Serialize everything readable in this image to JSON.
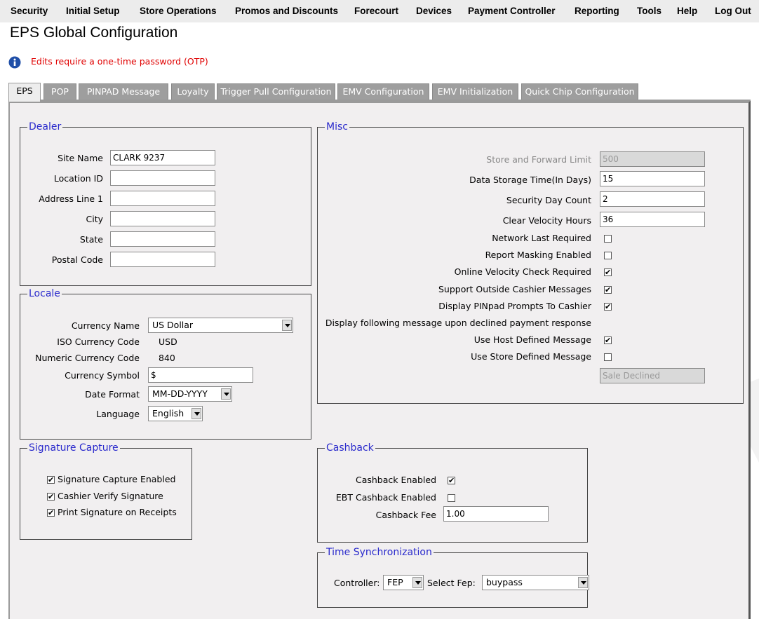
{
  "menu": [
    {
      "id": "security",
      "label": "Security"
    },
    {
      "id": "initial-setup",
      "label": "Initial Setup"
    },
    {
      "id": "store-operations",
      "label": "Store Operations"
    },
    {
      "id": "promos",
      "label": "Promos and Discounts"
    },
    {
      "id": "forecourt",
      "label": "Forecourt"
    },
    {
      "id": "devices",
      "label": "Devices"
    },
    {
      "id": "payment-controller",
      "label": "Payment Controller"
    },
    {
      "id": "reporting",
      "label": "Reporting"
    },
    {
      "id": "tools",
      "label": "Tools"
    },
    {
      "id": "help",
      "label": "Help"
    },
    {
      "id": "logout",
      "label": "Log Out"
    }
  ],
  "page": {
    "title": "EPS Global Configuration",
    "otp_message": "Edits require a one-time password (OTP)"
  },
  "tabs": [
    {
      "label": "EPS",
      "active": true
    },
    {
      "label": "POP"
    },
    {
      "label": "PINPAD Message"
    },
    {
      "label": "Loyalty"
    },
    {
      "label": "Trigger Pull Configuration"
    },
    {
      "label": "EMV Configuration"
    },
    {
      "label": "EMV Initialization"
    },
    {
      "label": "Quick Chip Configuration"
    }
  ],
  "dealer": {
    "legend": "Dealer",
    "fields": [
      {
        "label": "Site Name",
        "value": "CLARK 9237"
      },
      {
        "label": "Location ID",
        "value": ""
      },
      {
        "label": "Address Line 1",
        "value": ""
      },
      {
        "label": "City",
        "value": ""
      },
      {
        "label": "State",
        "value": ""
      },
      {
        "label": "Postal Code",
        "value": ""
      }
    ]
  },
  "locale": {
    "legend": "Locale",
    "currency_name_label": "Currency Name",
    "currency_name": "US Dollar",
    "iso_label": "ISO Currency Code",
    "iso_value": "USD",
    "numeric_label": "Numeric Currency Code",
    "numeric_value": "840",
    "symbol_label": "Currency Symbol",
    "symbol_value": "$",
    "date_format_label": "Date Format",
    "date_format": "MM-DD-YYYY",
    "language_label": "Language",
    "language": "English"
  },
  "signature": {
    "legend": "Signature Capture",
    "items": [
      {
        "label": "Signature Capture Enabled",
        "checked": true
      },
      {
        "label": "Cashier Verify Signature",
        "checked": true
      },
      {
        "label": "Print Signature on Receipts",
        "checked": true
      }
    ]
  },
  "misc": {
    "legend": "Misc",
    "store_forward_label": "Store and Forward Limit",
    "store_forward_value": "500",
    "data_storage_label": "Data Storage Time(In Days)",
    "data_storage_value": "15",
    "security_day_label": "Security Day Count",
    "security_day_value": "2",
    "clear_velocity_label": "Clear Velocity Hours",
    "clear_velocity_value": "36",
    "checks": [
      {
        "label": "Network Last Required",
        "checked": false
      },
      {
        "label": "Report Masking Enabled",
        "checked": false
      },
      {
        "label": "Online Velocity Check Required",
        "checked": true
      },
      {
        "label": "Support Outside Cashier Messages",
        "checked": true
      },
      {
        "label": "Display PINpad Prompts To Cashier",
        "checked": true
      }
    ],
    "declined_note": "Display following message upon declined payment response",
    "host_msg_label": "Use Host Defined Message",
    "host_msg_checked": true,
    "store_msg_label": "Use Store Defined Message",
    "store_msg_checked": false,
    "store_msg_value": "Sale Declined"
  },
  "cashback": {
    "legend": "Cashback",
    "enabled_label": "Cashback Enabled",
    "enabled": true,
    "ebt_label": "EBT Cashback Enabled",
    "ebt": false,
    "fee_label": "Cashback Fee",
    "fee_value": "1.00"
  },
  "timesync": {
    "legend": "Time Synchronization",
    "controller_label": "Controller:",
    "controller_value": "FEP",
    "fep_label": "Select Fep:",
    "fep_value": "buypass"
  },
  "colors": {
    "legend_text": "#2a2acc",
    "otp_text": "#e00000",
    "tab_inactive": "#9e9e9e",
    "panel_bg": "#f1eff0"
  },
  "icons": {
    "info": "info-icon",
    "checkmark": "✔"
  }
}
